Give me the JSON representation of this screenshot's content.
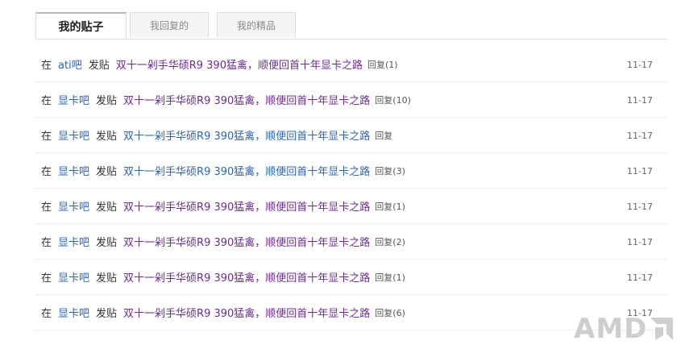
{
  "tabs": [
    {
      "label": "我的贴子",
      "active": true
    },
    {
      "label": "我回复的",
      "active": false
    },
    {
      "label": "我的精品",
      "active": false
    }
  ],
  "posts": [
    {
      "prefix": "在",
      "forum": "ati吧",
      "action": "发贴",
      "title": "双十一剁手华硕R9 390猛禽，顺便回首十年显卡之路",
      "reply": "回复(1)",
      "date": "11-17"
    },
    {
      "prefix": "在",
      "forum": "显卡吧",
      "action": "发贴",
      "title": "双十一剁手华硕R9 390猛禽，顺便回首十年显卡之路",
      "reply": "回复(10)",
      "date": "11-17"
    },
    {
      "prefix": "在",
      "forum": "显卡吧",
      "action": "发贴",
      "title": "双十一剁手华硕R9 390猛禽，顺便回首十年显卡之路",
      "reply": "回复",
      "date": "11-17"
    },
    {
      "prefix": "在",
      "forum": "显卡吧",
      "action": "发贴",
      "title": "双十一剁手华硕R9 390猛禽，顺便回首十年显卡之路",
      "reply": "回复(3)",
      "date": "11-17"
    },
    {
      "prefix": "在",
      "forum": "显卡吧",
      "action": "发贴",
      "title": "双十一剁手华硕R9 390猛禽，顺便回首十年显卡之路",
      "reply": "回复(1)",
      "date": "11-17"
    },
    {
      "prefix": "在",
      "forum": "显卡吧",
      "action": "发贴",
      "title": "双十一剁手华硕R9 390猛禽，顺便回首十年显卡之路",
      "reply": "回复(2)",
      "date": "11-17"
    },
    {
      "prefix": "在",
      "forum": "显卡吧",
      "action": "发贴",
      "title": "双十一剁手华硕R9 390猛禽，顺便回首十年显卡之路",
      "reply": "回复(1)",
      "date": "11-17"
    },
    {
      "prefix": "在",
      "forum": "显卡吧",
      "action": "发贴",
      "title": "双十一剁手华硕R9 390猛禽，顺便回首十年显卡之路",
      "reply": "回复(6)",
      "date": "11-17"
    }
  ],
  "watermark": {
    "text": "AMD"
  }
}
